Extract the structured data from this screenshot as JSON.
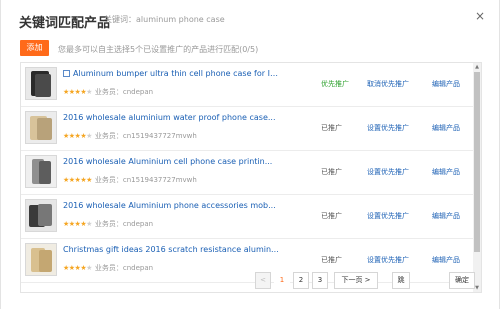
{
  "dialog": {
    "title": "关键词匹配产品",
    "keyword": "关键词：aluminum phone case",
    "close_icon": "×"
  },
  "toolbar": {
    "add_label": "添加",
    "hint": "您最多可以自主选择5个已设置推广的产品进行匹配(0/5)"
  },
  "rows": [
    {
      "name": "Aluminum bumper ultra thin cell phone case for Ip...",
      "stars": "★★★★",
      "stars_off": "★",
      "salesperson": "业务员：cndepan",
      "status": "优先推广",
      "action1": "取消优先推广",
      "action2": "编辑产品"
    },
    {
      "name": "2016 wholesale aluminium water proof phone case...",
      "stars": "★★★★",
      "stars_off": "★",
      "salesperson": "业务员：cn1519437727mvwh",
      "status": "已推广",
      "action1": "设置优先推广",
      "action2": "编辑产品"
    },
    {
      "name": "2016 wholesale Aluminium cell phone case printin...",
      "stars": "★★★★★",
      "stars_off": "",
      "salesperson": "业务员：cn1519437727mvwh",
      "status": "已推广",
      "action1": "设置优先推广",
      "action2": "编辑产品"
    },
    {
      "name": "2016 wholesale Aluminium phone accessories mob...",
      "stars": "★★★★",
      "stars_off": "★",
      "salesperson": "业务员：cndepan",
      "status": "已推广",
      "action1": "设置优先推广",
      "action2": "编辑产品"
    },
    {
      "name": "Christmas gift ideas 2016 scratch resistance alumin...",
      "stars": "★★★★",
      "stars_off": "★",
      "salesperson": "业务员：cndepan",
      "status": "已推广",
      "action1": "设置优先推广",
      "action2": "编辑产品"
    }
  ],
  "pagination": {
    "prev": "<",
    "pages": [
      "1",
      "2",
      "3"
    ],
    "current": "1",
    "next": "下一页 >",
    "jump": "跳",
    "confirm": "确定"
  },
  "colors": {
    "accent": "#ff6a1a",
    "link": "#1a5fb4",
    "priority": "#2ca02c"
  }
}
